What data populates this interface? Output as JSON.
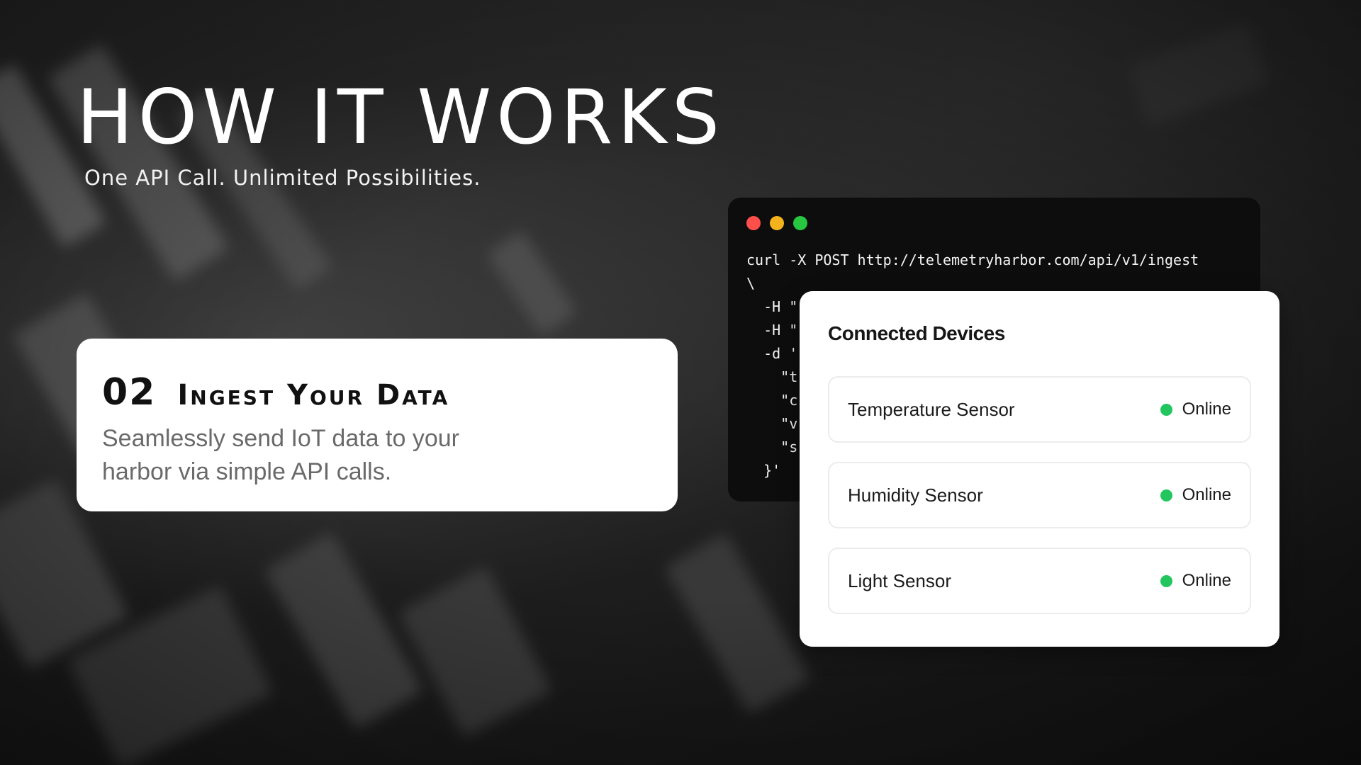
{
  "header": {
    "title": "HOW IT WORKS",
    "subtitle": "One API Call. Unlimited Possibilities."
  },
  "step": {
    "number": "02",
    "title": "Ingest Your Data",
    "description": "Seamlessly send IoT data to your harbor via simple API calls."
  },
  "terminal": {
    "lines": [
      "curl -X POST http://telemetryharbor.com/api/v1/ingest",
      "\\",
      "  -H \"",
      "  -H \"",
      "  -d '",
      "    \"t",
      "    \"c",
      "    \"v",
      "    \"s",
      "  }'"
    ]
  },
  "devices": {
    "title": "Connected Devices",
    "items": [
      {
        "name": "Temperature Sensor",
        "status": "Online"
      },
      {
        "name": "Humidity Sensor",
        "status": "Online"
      },
      {
        "name": "Light Sensor",
        "status": "Online"
      }
    ]
  },
  "colors": {
    "status_online": "#22c55e",
    "window_close": "#ff4f4b",
    "window_minimize": "#f4b31c",
    "window_maximize": "#27c840"
  }
}
